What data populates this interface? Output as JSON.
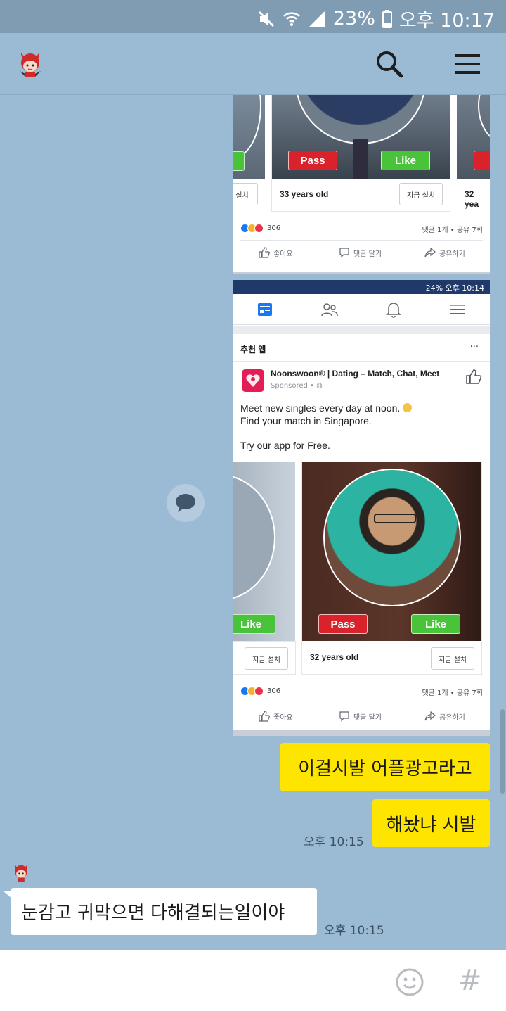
{
  "status_bar": {
    "battery": "23%",
    "time": "오후 10:17"
  },
  "shot_top": {
    "caption": "33 years old",
    "pass": "Pass",
    "like": "Like",
    "install_left": "설치",
    "install": "지금 설치",
    "caption_right": "32 yea",
    "reaction_count": "306",
    "stats": "댓글 1개 • 공유 7회",
    "like_action": "좋아요",
    "comment_action": "댓글 달기",
    "share_action": "공유하기"
  },
  "shot_bottom": {
    "inner_status": "24% 오후 10:14",
    "section_title": "추천 앱",
    "more": "···",
    "ad_title": "Noonswoon® | Dating – Match, Chat, Meet",
    "sponsored": "Sponsored • ",
    "line1": "Meet new singles every day at noon.",
    "line2": "Find your match in Singapore.",
    "line3": "Try our app for Free.",
    "like_left": "Like",
    "pass": "Pass",
    "like": "Like",
    "install": "지금 설치",
    "caption": "32 years old",
    "reaction_count": "306",
    "stats": "댓글 1개 • 공유 7회",
    "like_action": "좋아요",
    "comment_action": "댓글 달기",
    "share_action": "공유하기"
  },
  "messages": [
    {
      "text": "이걸시발 어플광고라고"
    },
    {
      "text": "해놨냐 시발",
      "time": "오후 10:15"
    },
    {
      "text": "눈감고 귀막으면 다해결되는일이야",
      "time": "오후 10:15"
    }
  ],
  "input": {
    "hash": "#"
  },
  "colors": {
    "chat_bg": "#9bbbd4",
    "my_bubble": "#fee500",
    "pass": "#d9222c",
    "like": "#49c33a"
  }
}
